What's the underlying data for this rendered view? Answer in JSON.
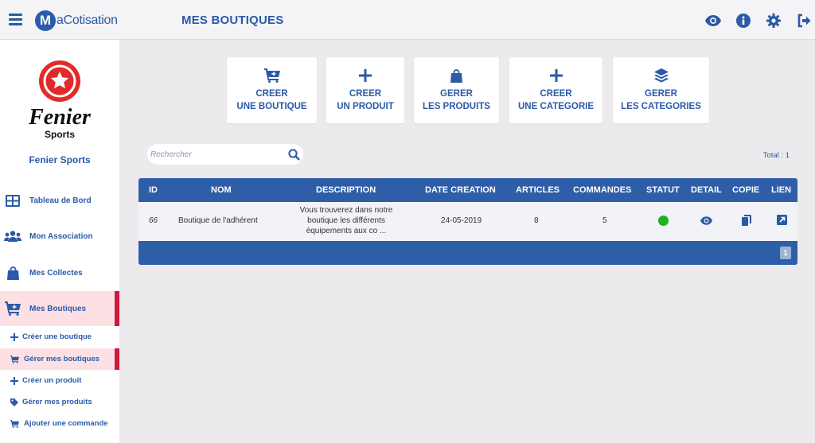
{
  "app": {
    "logo_letter": "M",
    "logo_text": "aCotisation"
  },
  "header": {
    "title": "MES BOUTIQUES"
  },
  "topbar_icons": [
    "eye-icon",
    "info-icon",
    "gear-icon",
    "logout-icon"
  ],
  "brand": {
    "logo_line1": "Fenier",
    "logo_line2": "Sports",
    "name": "Fenier Sports"
  },
  "sidebar": {
    "items": [
      {
        "label": "Tableau de Bord",
        "icon": "dashboard-icon"
      },
      {
        "label": "Mon Association",
        "icon": "users-icon"
      },
      {
        "label": "Mes Collectes",
        "icon": "bag-icon"
      },
      {
        "label": "Mes Boutiques",
        "icon": "cart-icon",
        "active": true
      }
    ],
    "subitems": [
      {
        "label": "Créer une boutique",
        "icon": "plus-icon"
      },
      {
        "label": "Gérer mes boutiques",
        "icon": "cart-icon",
        "active": true
      },
      {
        "label": "Créer un produit",
        "icon": "plus-icon"
      },
      {
        "label": "Gérer mes produits",
        "icon": "tag-icon"
      },
      {
        "label": "Ajouter une commande",
        "icon": "cart-icon"
      }
    ]
  },
  "actions": [
    {
      "line1": "CREER",
      "line2": "UNE BOUTIQUE",
      "icon": "cart-plus-icon"
    },
    {
      "line1": "CREER",
      "line2": "UN PRODUIT",
      "icon": "plus-icon"
    },
    {
      "line1": "GERER",
      "line2": "LES PRODUITS",
      "icon": "bag-icon"
    },
    {
      "line1": "CREER",
      "line2": "UNE CATEGORIE",
      "icon": "plus-icon"
    },
    {
      "line1": "GERER",
      "line2": "LES CATEGORIES",
      "icon": "layers-icon"
    }
  ],
  "search": {
    "placeholder": "Rechercher",
    "value": ""
  },
  "total": "Total : 1",
  "table": {
    "columns": [
      "ID",
      "NOM",
      "DESCRIPTION",
      "DATE CREATION",
      "ARTICLES",
      "COMMANDES",
      "STATUT",
      "DETAIL",
      "COPIE",
      "LIEN"
    ],
    "rows": [
      {
        "id": "66",
        "nom": "Boutique de l'adhérent",
        "description_l1": "Vous trouverez dans notre",
        "description_l2": "boutique les différents",
        "description_l3": "équipements aux co ...",
        "date": "24-05-2019",
        "articles": "8",
        "commandes": "5",
        "statut_color": "#1fb31f"
      }
    ]
  },
  "pagination": {
    "current": "1"
  },
  "colors": {
    "primary": "#2b5aa8",
    "table_header": "#2f5ea8",
    "accent": "#d0173d",
    "active_bg": "#fde0e4"
  }
}
